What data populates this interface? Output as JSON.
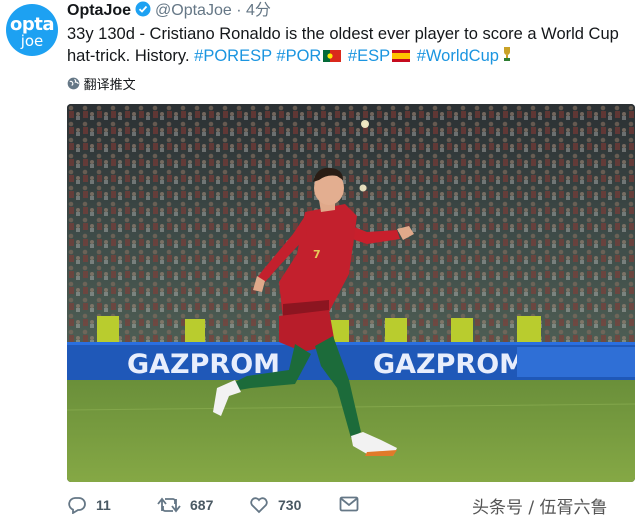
{
  "avatar": {
    "line1": "opta",
    "line2": "joe"
  },
  "author": {
    "name": "OptaJoe",
    "handle": "@OptaJoe",
    "separator": "·",
    "time": "4分"
  },
  "tweet": {
    "text": "33y 130d - Cristiano Ronaldo is the oldest ever player to score a World Cup hat-trick. History. ",
    "hashtags": [
      "#PORESP",
      "#POR",
      "#ESP",
      "#WorldCup"
    ]
  },
  "translate_label": "翻译推文",
  "photo": {
    "banner_text": "GAZPROM",
    "jersey_number": "7"
  },
  "actions": {
    "reply_count": "11",
    "retweet_count": "687",
    "like_count": "730"
  },
  "watermark": "头条号 / 伍胥六鲁",
  "colors": {
    "accent": "#1da1f2",
    "link": "#1b95e0",
    "muted": "#657786"
  }
}
